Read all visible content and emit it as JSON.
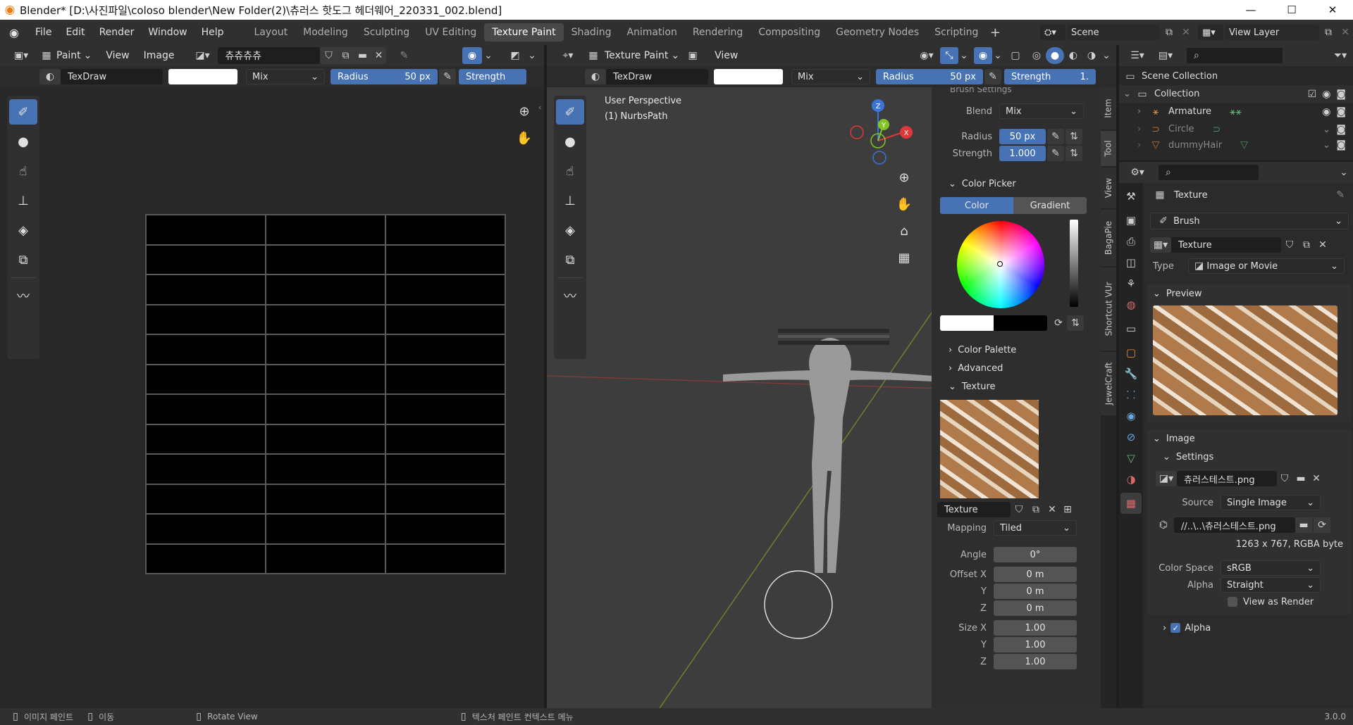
{
  "titlebar": {
    "title": "Blender* [D:\\사진파일\\coloso blender\\New Folder(2)\\츄러스 핫도그 헤더웨어_220331_002.blend]",
    "minimize": "—",
    "maximize": "☐",
    "close": "✕"
  },
  "menu": {
    "file": "File",
    "edit": "Edit",
    "render": "Render",
    "window": "Window",
    "help": "Help"
  },
  "workspaces": [
    "Layout",
    "Modeling",
    "Sculpting",
    "UV Editing",
    "Texture Paint",
    "Shading",
    "Animation",
    "Rendering",
    "Compositing",
    "Geometry Nodes",
    "Scripting"
  ],
  "active_workspace": "Texture Paint",
  "scene": {
    "label": "Scene",
    "view_layer": "View Layer"
  },
  "image_editor": {
    "mode": "Paint",
    "view": "View",
    "image": "Image",
    "image_name": "츄츄츄츄",
    "brush": "TexDraw",
    "blend": "Mix",
    "radius_label": "Radius",
    "radius_value": "50 px",
    "strength_label": "Strength",
    "grid_rows": 12,
    "grid_cols": 3
  },
  "viewport": {
    "mode": "Texture Paint",
    "view": "View",
    "brush": "TexDraw",
    "blend": "Mix",
    "radius_label": "Radius",
    "radius_value": "50 px",
    "strength_label": "Strength",
    "strength_value": "1.",
    "perspective": "User Perspective",
    "object": "(1) NurbsPath",
    "gizmo": {
      "z": "Z",
      "y": "Y",
      "x": "X"
    }
  },
  "npanel": {
    "header": "Brush Settings",
    "blend_label": "Blend",
    "blend": "Mix",
    "radius_label": "Radius",
    "radius": "50 px",
    "strength_label": "Strength",
    "strength": "1.000",
    "color_picker": "Color Picker",
    "color_tab": "Color",
    "gradient_tab": "Gradient",
    "color_palette": "Color Palette",
    "advanced": "Advanced",
    "texture_section": "Texture",
    "texture_name": "Texture",
    "mapping_label": "Mapping",
    "mapping": "Tiled",
    "angle_label": "Angle",
    "angle": "0°",
    "offset_x_label": "Offset X",
    "offset_x": "0 m",
    "offset_y_label": "Y",
    "offset_y": "0 m",
    "offset_z_label": "Z",
    "offset_z": "0 m",
    "size_x_label": "Size X",
    "size_x": "1.00",
    "size_y_label": "Y",
    "size_y": "1.00",
    "size_z_label": "Z",
    "size_z": "1.00",
    "tabs": [
      "Item",
      "Tool",
      "View",
      "BagaPie",
      "Shortcut VUr",
      "JewelCraft"
    ]
  },
  "outliner": {
    "scene_collection": "Scene Collection",
    "collection": "Collection",
    "items": [
      "Armature",
      "Circle",
      "dummyHair"
    ]
  },
  "properties": {
    "texture_header": "Texture",
    "brush": "Brush",
    "texture_name": "Texture",
    "type_label": "Type",
    "type": "Image or Movie",
    "preview": "Preview",
    "image_section": "Image",
    "settings": "Settings",
    "image_name": "츄러스테스트.png",
    "source_label": "Source",
    "source": "Single Image",
    "filepath": "//..\\..\\츄러스테스트.png",
    "resolution": "1263 x 767,  RGBA byte",
    "color_space_label": "Color Space",
    "color_space": "sRGB",
    "alpha_label": "Alpha",
    "alpha": "Straight",
    "view_as_render": "View as Render",
    "alpha_check": "Alpha"
  },
  "statusbar": {
    "image_paint": "이미지 페인트",
    "move": "이동",
    "rotate_view": "Rotate View",
    "context_menu": "텍스처 페인트 컨텍스트 메뉴",
    "version": "3.0.0"
  },
  "colors": {
    "accent": "#4772b3",
    "bg": "#1d1d1d",
    "panel": "#303030"
  }
}
